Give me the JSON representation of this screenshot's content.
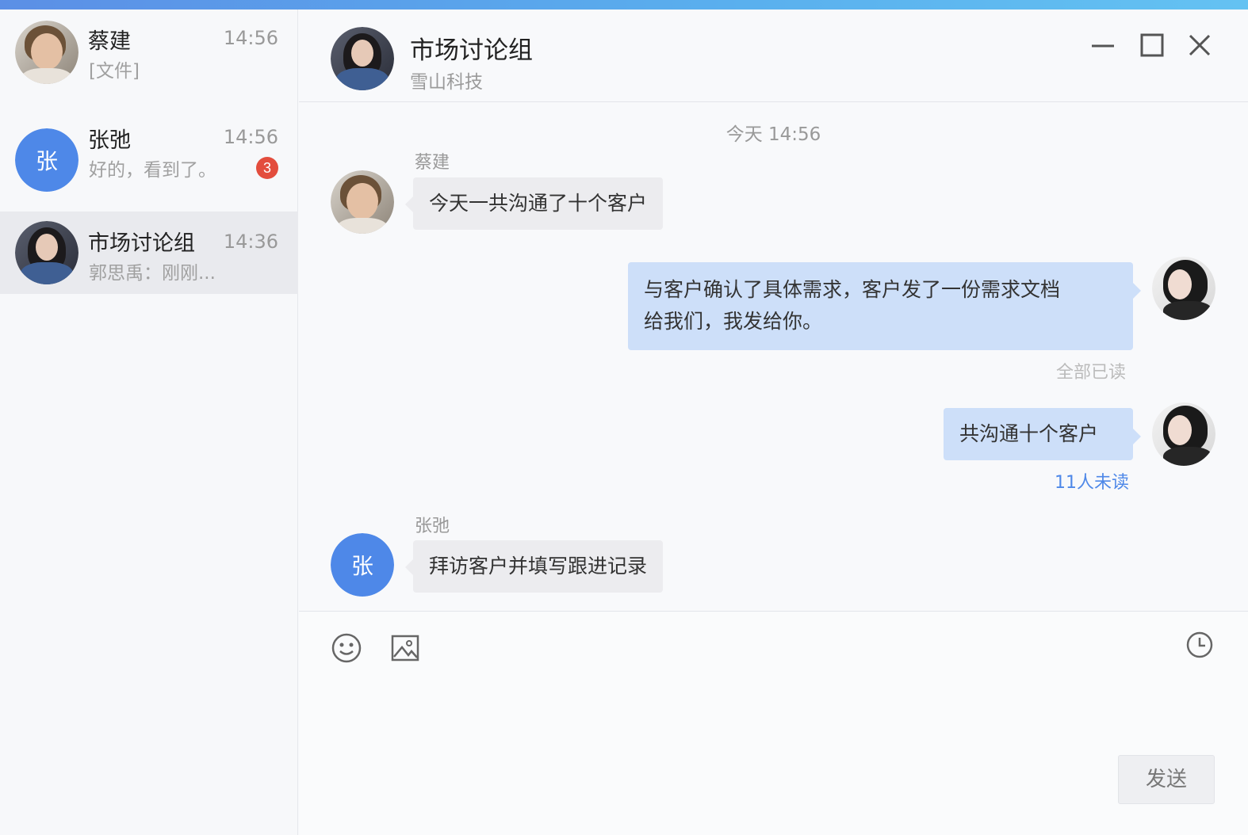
{
  "sidebar": {
    "conversations": [
      {
        "name": "蔡建",
        "time": "14:56",
        "preview": "[文件]"
      },
      {
        "name": "张弛",
        "time": "14:56",
        "preview": "好的，看到了。",
        "avatar_letter": "张",
        "unread": "3"
      },
      {
        "name": "市场讨论组",
        "time": "14:36",
        "preview": "郭思禹：刚刚..."
      }
    ]
  },
  "header": {
    "title": "市场讨论组",
    "subtitle": "雪山科技",
    "window_controls": [
      "minimize-icon",
      "maximize-icon",
      "close-icon"
    ]
  },
  "chat": {
    "timestamp": "今天 14:56",
    "messages": [
      {
        "direction": "in",
        "sender": "蔡建",
        "text": "今天一共沟通了十个客户"
      },
      {
        "direction": "out",
        "text_line1": "与客户确认了具体需求，客户发了一份需求文档",
        "text_line2": "给我们，我发给你。",
        "status": "全部已读"
      },
      {
        "direction": "out",
        "text": "共沟通十个客户",
        "status": "11人未读"
      },
      {
        "direction": "in",
        "sender": "张弛",
        "avatar_letter": "张",
        "text": "拜访客户并填写跟进记录"
      }
    ]
  },
  "composer": {
    "tools": [
      "emoji-icon",
      "image-icon",
      "history-clock-icon"
    ],
    "send_label": "发送"
  },
  "colors": {
    "accent": "#4e88e8",
    "outgoing_bubble": "#cddff9",
    "incoming_bubble": "#ececef",
    "unread_status": "#4e88e8",
    "read_status": "#bbbbbb",
    "badge": "#e34d3d"
  }
}
